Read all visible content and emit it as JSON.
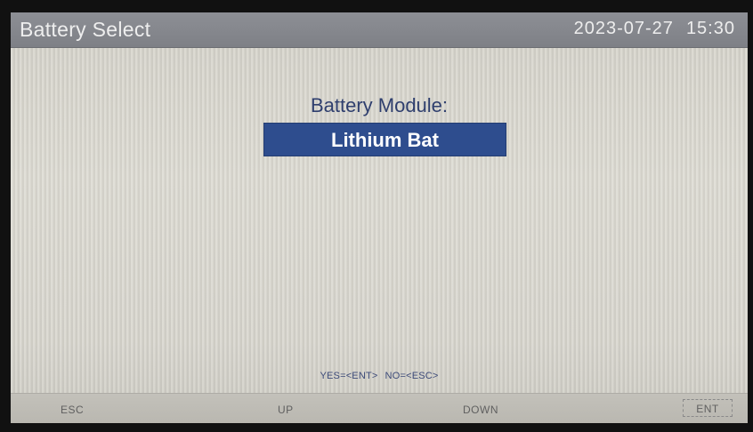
{
  "header": {
    "title": "Battery Select",
    "date": "2023-07-27",
    "time": "15:30"
  },
  "main": {
    "label": "Battery Module:",
    "selected_value": "Lithium Bat",
    "prompt_yes": "YES=<ENT>",
    "prompt_no": "NO=<ESC>"
  },
  "softkeys": {
    "esc": "ESC",
    "up": "UP",
    "down": "DOWN",
    "ent": "ENT"
  },
  "colors": {
    "title_bar": "#7e8086",
    "selection_highlight": "#2e4d8e",
    "label_text": "#2f3f6e"
  }
}
